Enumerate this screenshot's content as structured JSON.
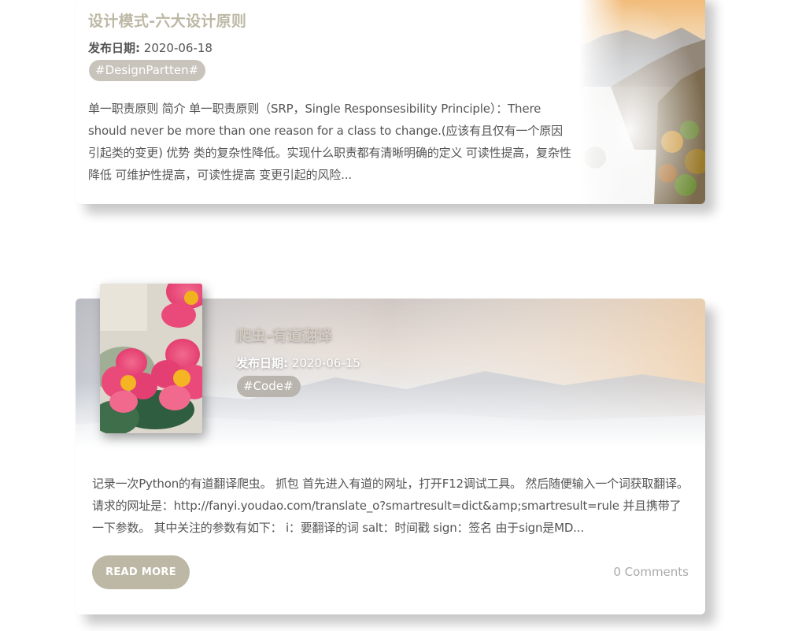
{
  "posts": [
    {
      "title": "设计模式-六大设计原则",
      "date_label": "发布日期:",
      "date": "2020-06-18",
      "tag": "#DesignPartten#",
      "excerpt": "单一职责原则 简介 单一职责原则（SRP，Single Responsesibility Principle）：There should never be more than one reason for a class to change.(应该有且仅有一个原因引起类的变更) 优势 类的复杂性降低。实现什么职责都有清晰明确的定义 可读性提高，复杂性降低 可维护性提高，可读性提高 变更引起的风险..."
    },
    {
      "title": "爬虫-有道翻译",
      "date_label": "发布日期:",
      "date": "2020-06-15",
      "tag": "#Code#",
      "excerpt": "记录一次Python的有道翻译爬虫。 抓包 首先进入有道的网址，打开F12调试工具。 然后随便输入一个词获取翻译。 请求的网址是：http://fanyi.youdao.com/translate_o?smartresult=dict&amp;smartresult=rule 并且携带了一下参数。 其中关注的参数有如下： i：要翻译的词 salt：时间戳 sign：签名 由于sign是MD...",
      "read_more": "READ MORE",
      "comments": "0 Comments"
    }
  ],
  "colors": {
    "accent": "#bdb8a5",
    "tag_bg": "#c8c3bb",
    "text": "#555555",
    "muted": "#aaaaaa"
  }
}
